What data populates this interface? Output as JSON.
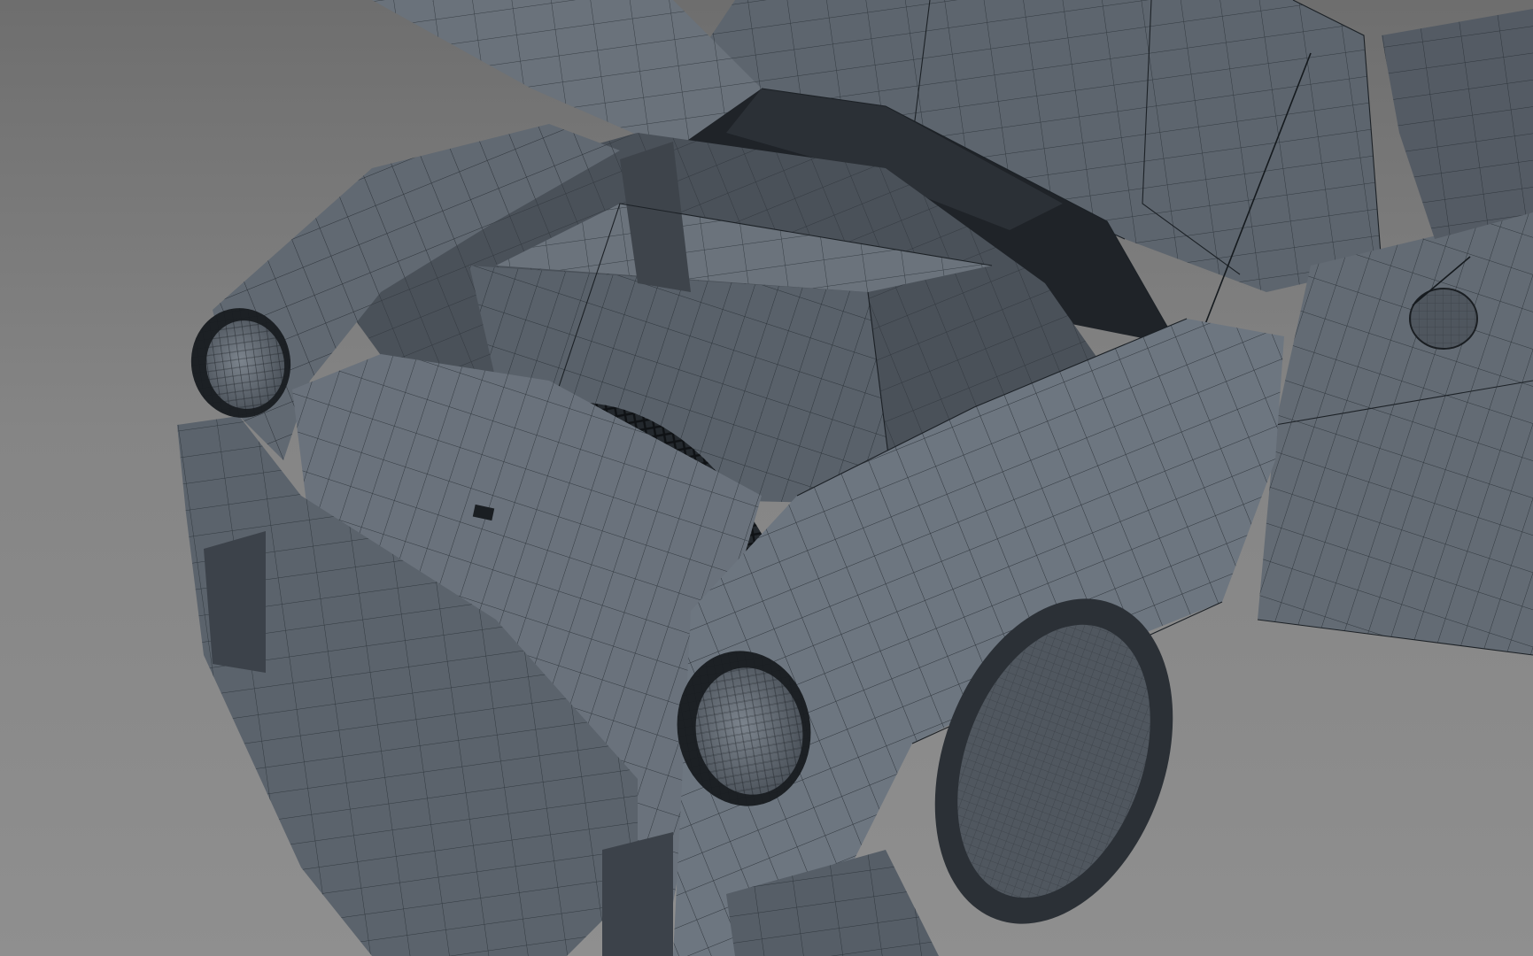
{
  "scene": {
    "description_visible_text": "",
    "colors": {
      "background_top": "#6e6e6e",
      "background_bottom": "#8f8f8f",
      "body_light": "#6d7680",
      "body_mid": "#5c646d",
      "body_dark": "#474e56",
      "cavity": "#3b4148",
      "shadow": "#1d2126",
      "wire": "#1c2126"
    }
  }
}
